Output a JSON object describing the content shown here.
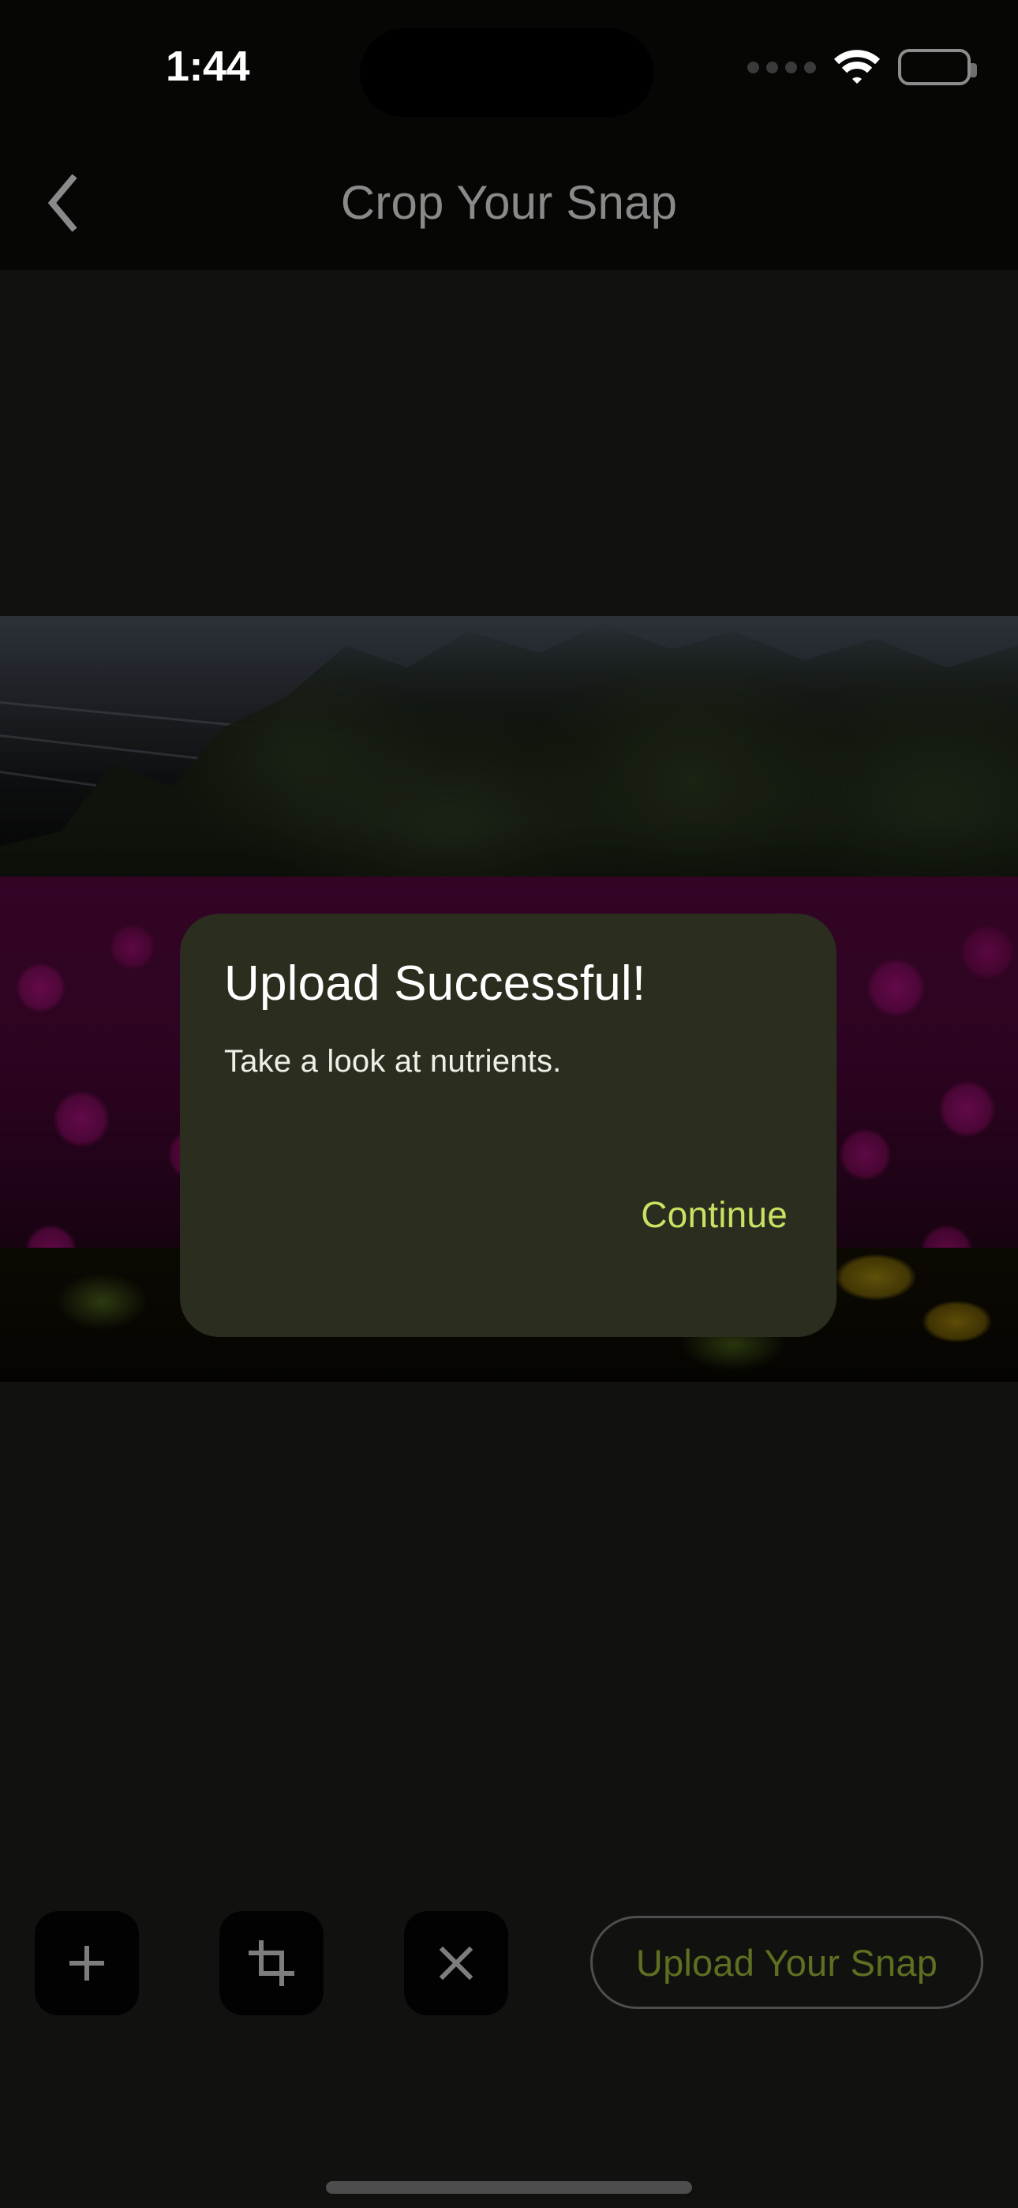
{
  "status_bar": {
    "time": "1:44",
    "cellular_icon": "cellular-dots-icon",
    "cellular_dots": 4,
    "wifi_icon": "wifi-icon",
    "battery_icon": "battery-icon",
    "battery_level_percent": 100
  },
  "nav_header": {
    "back_icon": "chevron-left-icon",
    "title": "Crop Your Snap"
  },
  "photo": {
    "subject": "magenta ice plant flowers with green shrub and overcast sky",
    "state": "dimmed-by-modal"
  },
  "toolbar": {
    "add_button": {
      "icon": "plus-icon",
      "label": "+"
    },
    "crop_button": {
      "icon": "crop-icon",
      "label": ""
    },
    "close_button": {
      "icon": "close-x-icon",
      "label": ""
    },
    "upload_button": {
      "label": "Upload Your Snap"
    }
  },
  "dialog": {
    "title": "Upload Successful!",
    "message": "Take a look at nutrients.",
    "continue_label": "Continue"
  },
  "colors": {
    "page_background": "#111210",
    "chrome_background": "#060704",
    "dialog_background": "#2b2e1f",
    "accent_continue": "#c8e263",
    "accent_upload_dimmed": "#5d7021",
    "nav_title": "#8a8a8a",
    "home_indicator": "#4d4d4d"
  },
  "home_indicator": {
    "name": "home-indicator"
  }
}
